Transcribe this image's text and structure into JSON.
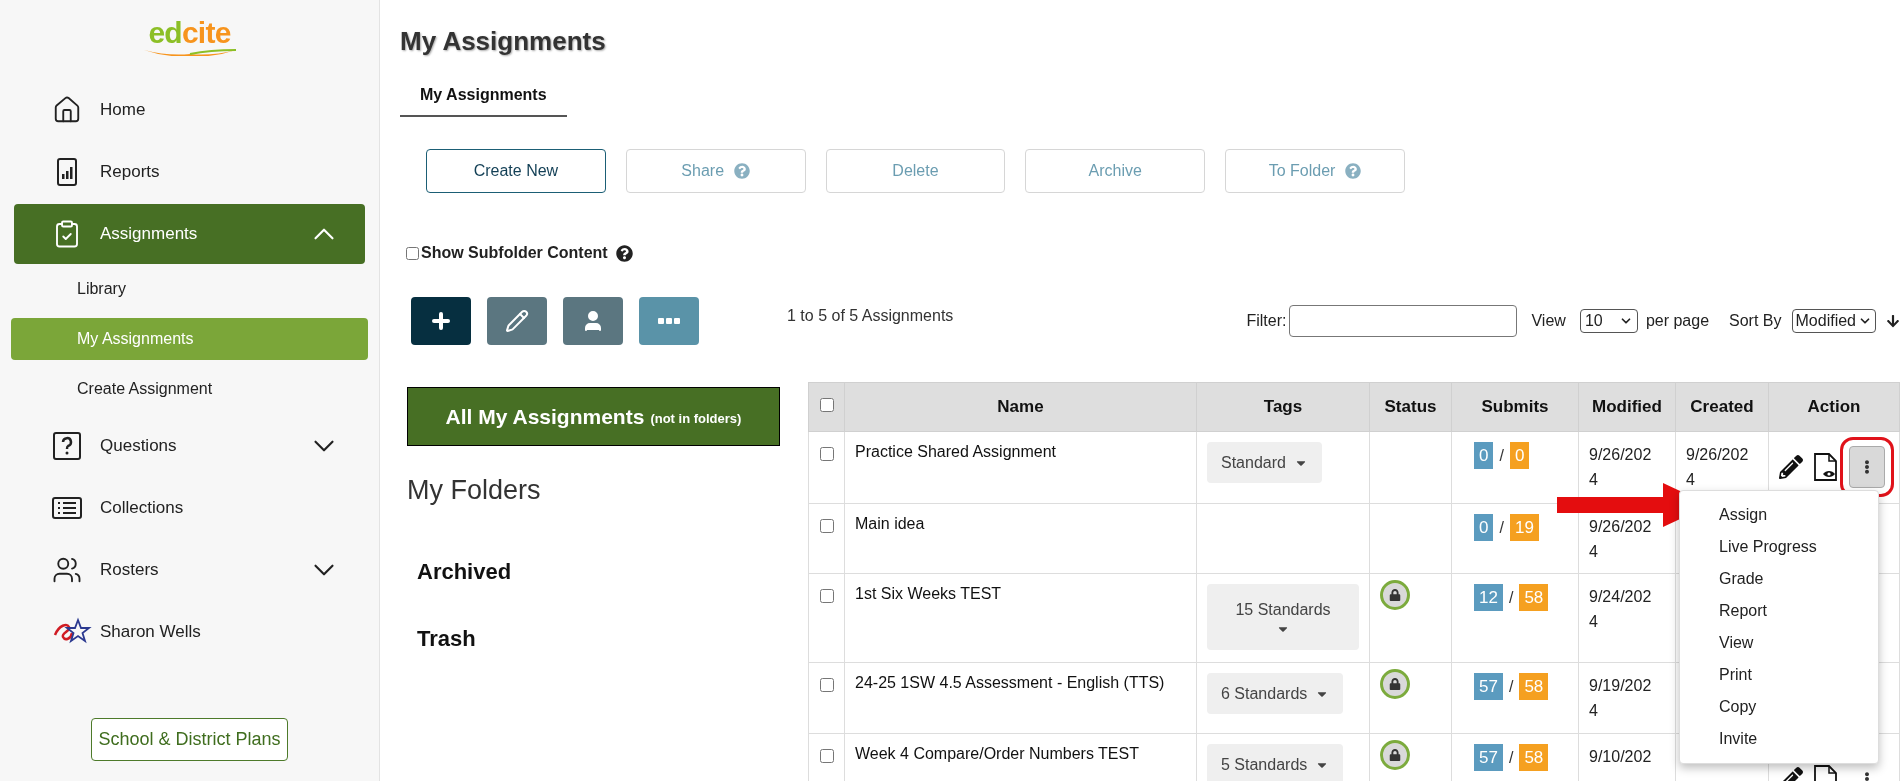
{
  "sidebar": {
    "logo": [
      "ed",
      "cite"
    ],
    "items": [
      {
        "kind": "home",
        "label": "Home",
        "selected": false
      },
      {
        "kind": "reports",
        "label": "Reports",
        "selected": false
      },
      {
        "kind": "assignments",
        "label": "Assignments",
        "selected": true,
        "expanded": true,
        "children": [
          {
            "label": "Library",
            "selected": false
          },
          {
            "label": "My Assignments",
            "selected": true
          },
          {
            "label": "Create Assignment",
            "selected": false
          }
        ]
      },
      {
        "kind": "questions",
        "label": "Questions",
        "selected": false,
        "expanded": false
      },
      {
        "kind": "collections",
        "label": "Collections",
        "selected": false
      },
      {
        "kind": "rosters",
        "label": "Rosters",
        "selected": false,
        "expanded": false
      },
      {
        "kind": "district",
        "label": "Sharon Wells",
        "selected": false
      }
    ],
    "plans_button": "School & District Plans"
  },
  "title": "My Assignments",
  "tabs": [
    {
      "label": "My Assignments",
      "selected": true
    }
  ],
  "action_buttons": [
    {
      "label": "Create New",
      "disabled": false,
      "help": false
    },
    {
      "label": "Share",
      "disabled": true,
      "help": true
    },
    {
      "label": "Delete",
      "disabled": true,
      "help": false
    },
    {
      "label": "Archive",
      "disabled": true,
      "help": false
    },
    {
      "label": "To Folder",
      "disabled": true,
      "help": true
    }
  ],
  "subfolder_option": {
    "label": "Show Subfolder Content",
    "checked": false
  },
  "tool_buttons": [
    {
      "kind": "add"
    },
    {
      "kind": "edit"
    },
    {
      "kind": "share"
    },
    {
      "kind": "more"
    }
  ],
  "count": "1 to 5 of 5 Assignments",
  "filter": {
    "label": "Filter:"
  },
  "view": {
    "label": "View",
    "value": "10",
    "suffix": "per page"
  },
  "sort": {
    "label": "Sort By",
    "value": "Modified"
  },
  "folders": {
    "all": {
      "label": "All My Assignments",
      "note": "(not in folders)",
      "selected": true
    },
    "heading": "My Folders",
    "items": [
      {
        "label": "Archived"
      },
      {
        "label": "Trash"
      }
    ]
  },
  "table": {
    "select_all_checked": false,
    "separator": "/",
    "columns": [
      "Name",
      "Tags",
      "Status",
      "Submits",
      "Modified",
      "Created",
      "Action"
    ],
    "rows": [
      {
        "checked": false,
        "name": "Practice Shared Assignment",
        "tag": "Standard",
        "locked": false,
        "submitted": "0",
        "total": "0",
        "modified": "9/26/2024",
        "created": "9/26/2024"
      },
      {
        "checked": false,
        "name": "Main idea",
        "locked": false,
        "submitted": "0",
        "total": "19",
        "modified": "9/26/2024"
      },
      {
        "checked": false,
        "name": "1st Six Weeks TEST",
        "tag": "15 Standards",
        "locked": true,
        "submitted": "12",
        "total": "58",
        "modified": "9/24/2024"
      },
      {
        "checked": false,
        "name": "24-25 1SW 4.5 Assessment - English (TTS)",
        "tag": "6 Standards",
        "locked": true,
        "submitted": "57",
        "total": "58",
        "modified": "9/19/2024"
      },
      {
        "checked": false,
        "name": "Week 4 Compare/Order Numbers TEST",
        "tag": "5 Standards",
        "locked": true,
        "submitted": "57",
        "total": "58",
        "modified": "9/10/202"
      }
    ]
  },
  "action_menu": {
    "open": true,
    "items": [
      "Assign",
      "Live Progress",
      "Grade",
      "Report",
      "View",
      "Print",
      "Copy",
      "Invite"
    ]
  }
}
